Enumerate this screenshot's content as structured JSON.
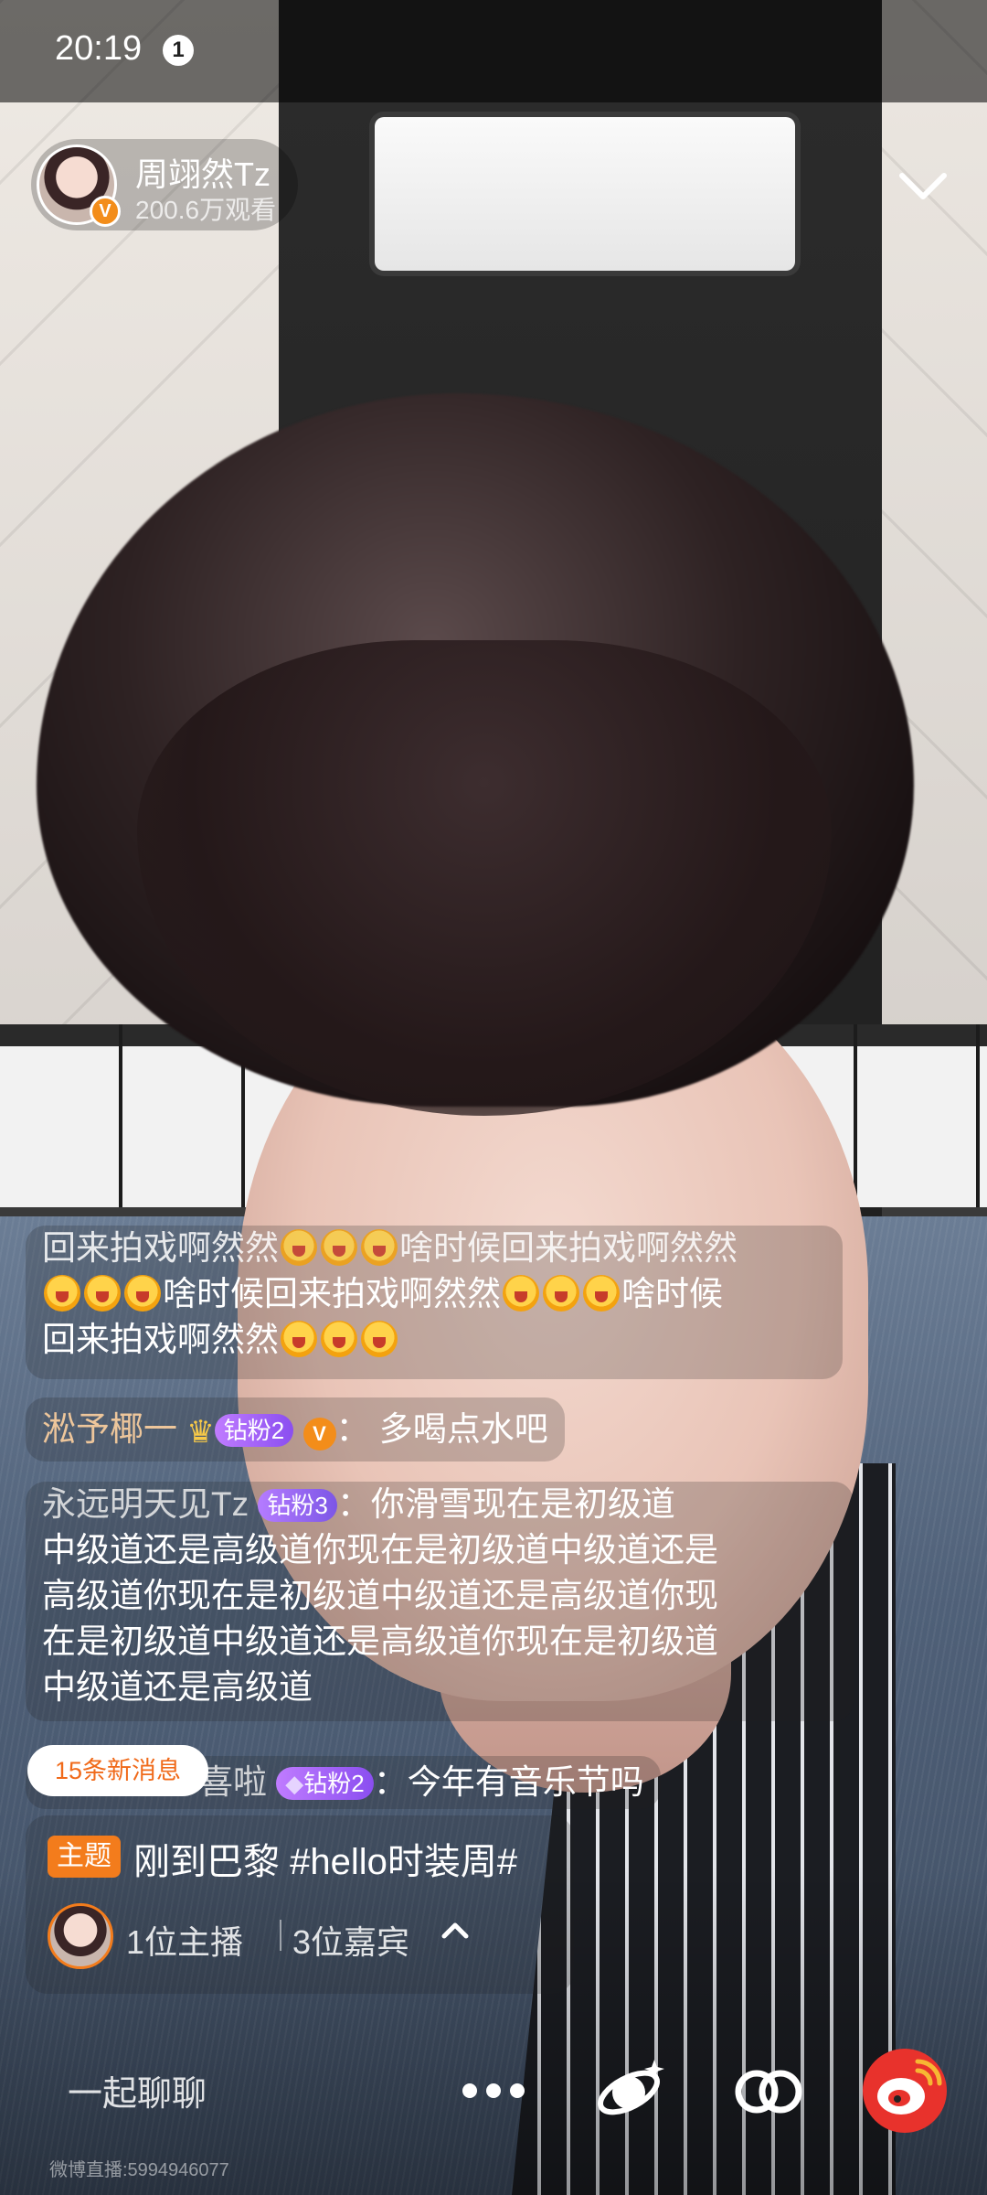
{
  "status_bar": {
    "time": "20:19",
    "notification_count": "1"
  },
  "host": {
    "name": "周翊然Tz",
    "viewers": "200.6万观看",
    "verified_mark": "V"
  },
  "comments": {
    "c1": {
      "line1": "回来拍戏啊然然",
      "line1b": "啥时候回来拍戏啊然然",
      "line2": "啥时候回来拍戏啊然然",
      "line2b": "啥时候",
      "line3": "回来拍戏啊然然"
    },
    "c2": {
      "user": "淞予椰一",
      "badge": "钻粉2",
      "v": "V",
      "text": "多喝点水吧"
    },
    "c3": {
      "user": "永远明天见Tz",
      "badge": "钻粉3",
      "line1": "你滑雪现在是初级道",
      "line2": "中级道还是高级道你现在是初级道中级道还是",
      "line3": "高级道你现在是初级道中级道还是高级道你现",
      "line4": "在是初级道中级道还是高级道你现在是初级道",
      "line5": "中级道还是高级道"
    },
    "c4": {
      "user": "喜啦",
      "badge": "钻粉2",
      "text": "今年有音乐节吗"
    }
  },
  "new_messages": "15条新消息",
  "topic": {
    "tag": "主题",
    "text": "刚到巴黎 #hello时装周#"
  },
  "guests": {
    "host_count": "1位主播",
    "guest_count": "3位嘉宾"
  },
  "bottom_bar": {
    "chat_placeholder": "一起聊聊",
    "watermark": "微博直播:5994946077"
  },
  "colors": {
    "accent_orange": "#f37c1c",
    "weibo_red": "#e8322c",
    "fan_badge_purple": "#8a4ef0"
  },
  "icons": [
    "chevron-down-icon",
    "crown-icon",
    "diamond-icon",
    "chevron-up-icon",
    "more-dots-icon",
    "feed-planet-icon",
    "link-icon",
    "weibo-logo-icon"
  ]
}
